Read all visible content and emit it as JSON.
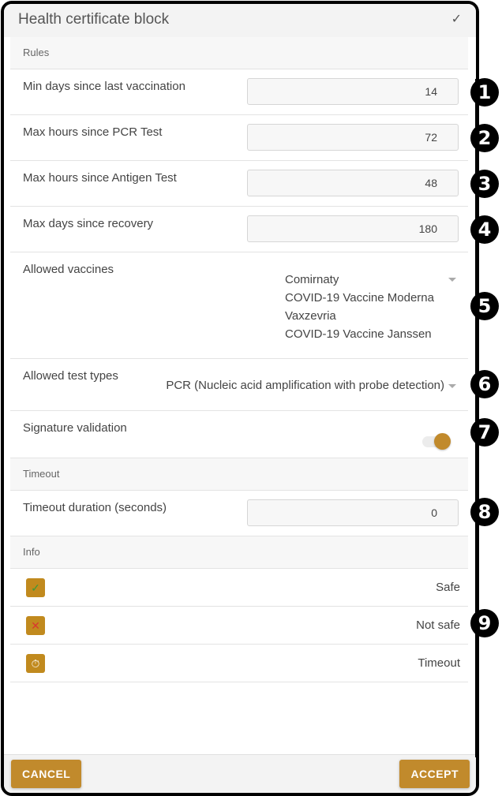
{
  "dialog": {
    "title": "Health certificate block",
    "header_icon": "checkmark-icon"
  },
  "sections": {
    "rules": "Rules",
    "timeout": "Timeout",
    "info": "Info"
  },
  "rules": {
    "min_days_vaccination": {
      "label": "Min days since last vaccination",
      "value": "14"
    },
    "max_hours_pcr": {
      "label": "Max hours since PCR Test",
      "value": "72"
    },
    "max_hours_antigen": {
      "label": "Max hours since Antigen Test",
      "value": "48"
    },
    "max_days_recovery": {
      "label": "Max days since recovery",
      "value": "180"
    },
    "allowed_vaccines": {
      "label": "Allowed vaccines",
      "selected": [
        "Comirnaty",
        "COVID-19 Vaccine Moderna",
        "Vaxzevria",
        "COVID-19 Vaccine Janssen"
      ]
    },
    "allowed_test_types": {
      "label": "Allowed test types",
      "selected": "PCR (Nucleic acid amplification with probe detection)"
    },
    "signature_validation": {
      "label": "Signature validation",
      "enabled": true
    }
  },
  "timeout": {
    "duration": {
      "label": "Timeout duration (seconds)",
      "value": "0"
    }
  },
  "info": [
    {
      "icon": "checkmark-icon",
      "glyph": "✓",
      "glyph_color": "#3a9a3a",
      "label": "Safe"
    },
    {
      "icon": "close-icon",
      "glyph": "✕",
      "glyph_color": "#d9382f",
      "label": "Not safe"
    },
    {
      "icon": "stopwatch-icon",
      "glyph": "⏱",
      "glyph_color": "#ffffff",
      "label": "Timeout"
    }
  ],
  "footer": {
    "cancel_label": "CANCEL",
    "accept_label": "ACCEPT"
  },
  "callouts": [
    "1",
    "2",
    "3",
    "4",
    "5",
    "6",
    "7",
    "8",
    "9"
  ],
  "colors": {
    "accent": "#c18a2c",
    "header_bg": "#f3f3f3"
  }
}
